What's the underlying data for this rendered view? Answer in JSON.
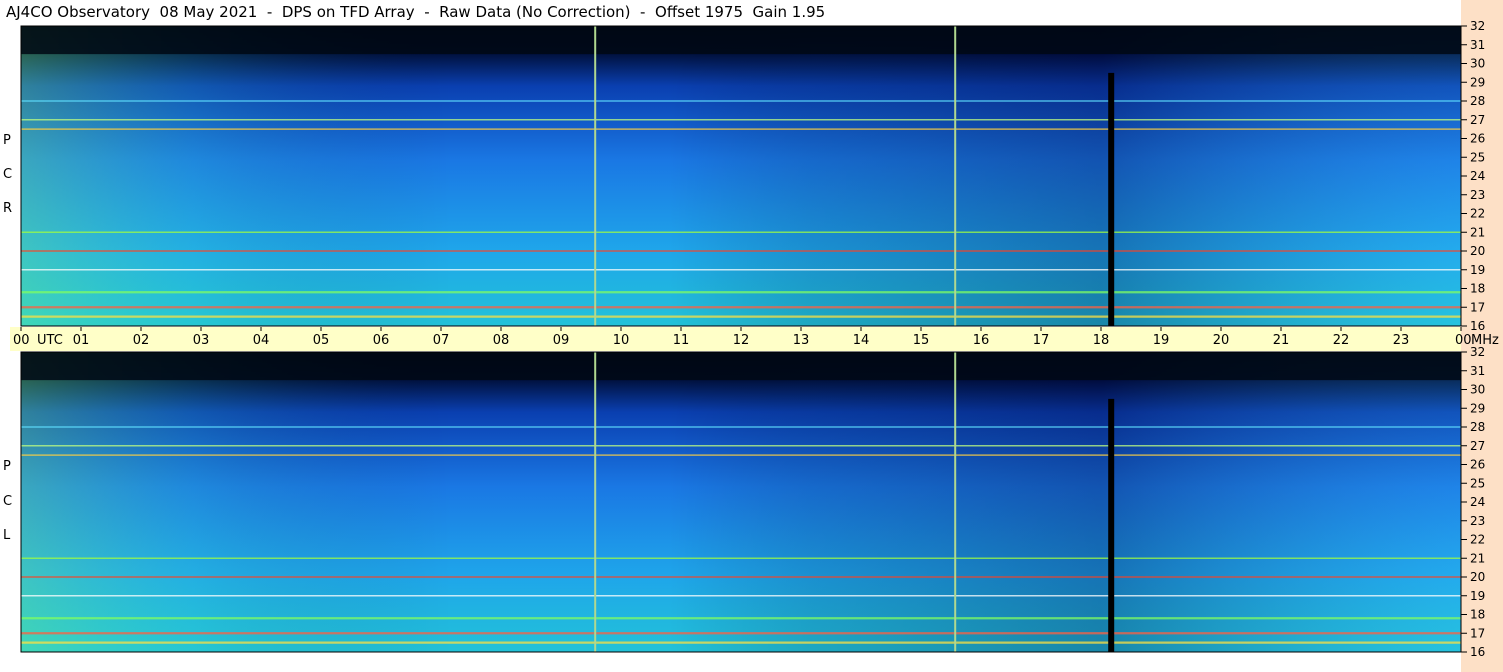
{
  "header": {
    "title": "AJ4CO Observatory  08 May 2021  -  DPS on TFD Array  -  Raw Data (No Correction)  -  Offset 1975  Gain 1.95"
  },
  "panels": [
    {
      "label_letters": [
        "P",
        "C",
        "R"
      ]
    },
    {
      "label_letters": [
        "P",
        "C",
        "L"
      ]
    }
  ],
  "colors": {
    "background_sky": "#1e90ee",
    "dark_band": "#000814",
    "accent_rfi": "#ff4020",
    "utc_bar": "#ffffc8",
    "right_pane": "#fde0c6"
  },
  "chart_data": {
    "type": "heatmap",
    "title": "AJ4CO Observatory  08 May 2021  -  DPS on TFD Array  -  Raw Data (No Correction)  -  Offset 1975  Gain 1.95",
    "x_tick_labels": [
      "00",
      "UTC",
      "01",
      "02",
      "03",
      "04",
      "05",
      "06",
      "07",
      "08",
      "09",
      "10",
      "11",
      "12",
      "13",
      "14",
      "15",
      "16",
      "17",
      "18",
      "19",
      "20",
      "21",
      "22",
      "23",
      "00",
      "MHz"
    ],
    "x_hours": [
      0,
      1,
      2,
      3,
      4,
      5,
      6,
      7,
      8,
      9,
      10,
      11,
      12,
      13,
      14,
      15,
      16,
      17,
      18,
      19,
      20,
      21,
      22,
      23,
      24
    ],
    "y_tick_labels": [
      "16",
      "17",
      "18",
      "19",
      "20",
      "21",
      "22",
      "23",
      "24",
      "25",
      "26",
      "27",
      "28",
      "29",
      "30",
      "31",
      "32"
    ],
    "y_mhz": [
      16,
      17,
      18,
      19,
      20,
      21,
      22,
      23,
      24,
      25,
      26,
      27,
      28,
      29,
      30,
      31,
      32
    ],
    "xlim": [
      0,
      24
    ],
    "ylim": [
      16,
      32
    ],
    "panels": [
      "RCP",
      "LCP"
    ],
    "vertical_markers_utc": [
      9.57,
      15.57
    ],
    "data_gap_utc": 18.17,
    "rfi_bands_mhz": [
      16.5,
      17.0,
      17.8,
      19.0,
      20.0,
      21.0,
      26.5,
      27.0,
      28.0
    ]
  }
}
